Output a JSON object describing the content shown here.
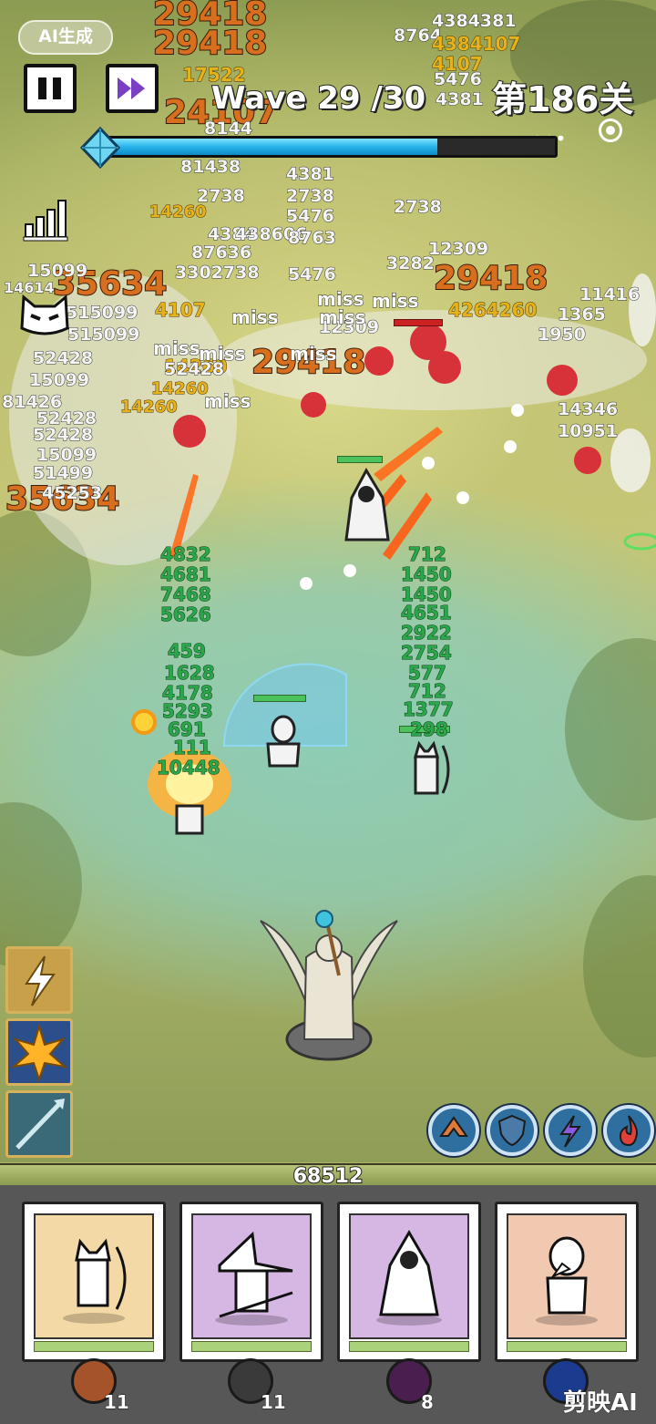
{
  "hud": {
    "ai_badge": "AI生成",
    "wave_label": "Wave 29 /30",
    "level_label": "第186关",
    "menu_dots": "•••",
    "wave_progress": 0.74
  },
  "damage_numbers": {
    "top": [
      "29418",
      "29418",
      "17522",
      "4107",
      "8764",
      "4384381",
      "4384107",
      "5476",
      "4381",
      "24107",
      "8144",
      "81438",
      "2738",
      "5476",
      "2738",
      "14260",
      "4384",
      "438606",
      "87636",
      "4381",
      "2738",
      "5476",
      "14260",
      "8763",
      "12309",
      "3302738",
      "3282"
    ],
    "big_orange": [
      "35634",
      "29418",
      "29418",
      "35634",
      "14260",
      "4107"
    ],
    "white_left": [
      "15099",
      "14614",
      "515099",
      "515099",
      "52428",
      "52428",
      "15099",
      "81426",
      "52428",
      "14260",
      "15099",
      "51499",
      "52428",
      "45253"
    ],
    "white_right": [
      "11416",
      "1365",
      "1950",
      "14346",
      "10951",
      "12309",
      "4264260"
    ],
    "green_left": [
      "4832",
      "4681",
      "7468",
      "5626",
      "459",
      "1628",
      "4178",
      "5293",
      "691",
      "111",
      "10448"
    ],
    "green_right": [
      "712",
      "1450",
      "1450",
      "4651",
      "2922",
      "2754",
      "577",
      "712",
      "1377",
      "298"
    ],
    "misses": [
      "miss",
      "miss",
      "miss",
      "miss",
      "miss",
      "miss",
      "miss",
      "miss"
    ]
  },
  "skills": [
    {
      "name": "lightning-skill"
    },
    {
      "name": "burst-skill"
    },
    {
      "name": "spear-skill"
    }
  ],
  "abilities": [
    {
      "name": "speed-ability",
      "color": "#2f6f9f"
    },
    {
      "name": "shield-ability",
      "color": "#2f6f9f"
    },
    {
      "name": "lightning-ability",
      "color": "#2f6f9f"
    },
    {
      "name": "fire-ability",
      "color": "#2f6f9f"
    }
  ],
  "base": {
    "hp": "68512"
  },
  "heroes": [
    {
      "name": "archer-cat",
      "bg": "#f3d9a6",
      "badge_color": "#a4532a",
      "count": "11"
    },
    {
      "name": "wizard",
      "bg": "#d6b7e3",
      "badge_color": "#3a3a3a",
      "count": "11"
    },
    {
      "name": "dark-mage",
      "bg": "#d6b7e3",
      "badge_color": "#4a1f4f",
      "count": "8"
    },
    {
      "name": "plague-doctor",
      "bg": "#f1c9b1",
      "badge_color": "#1b3b8f",
      "count": ""
    }
  ],
  "watermark": "剪映AI"
}
